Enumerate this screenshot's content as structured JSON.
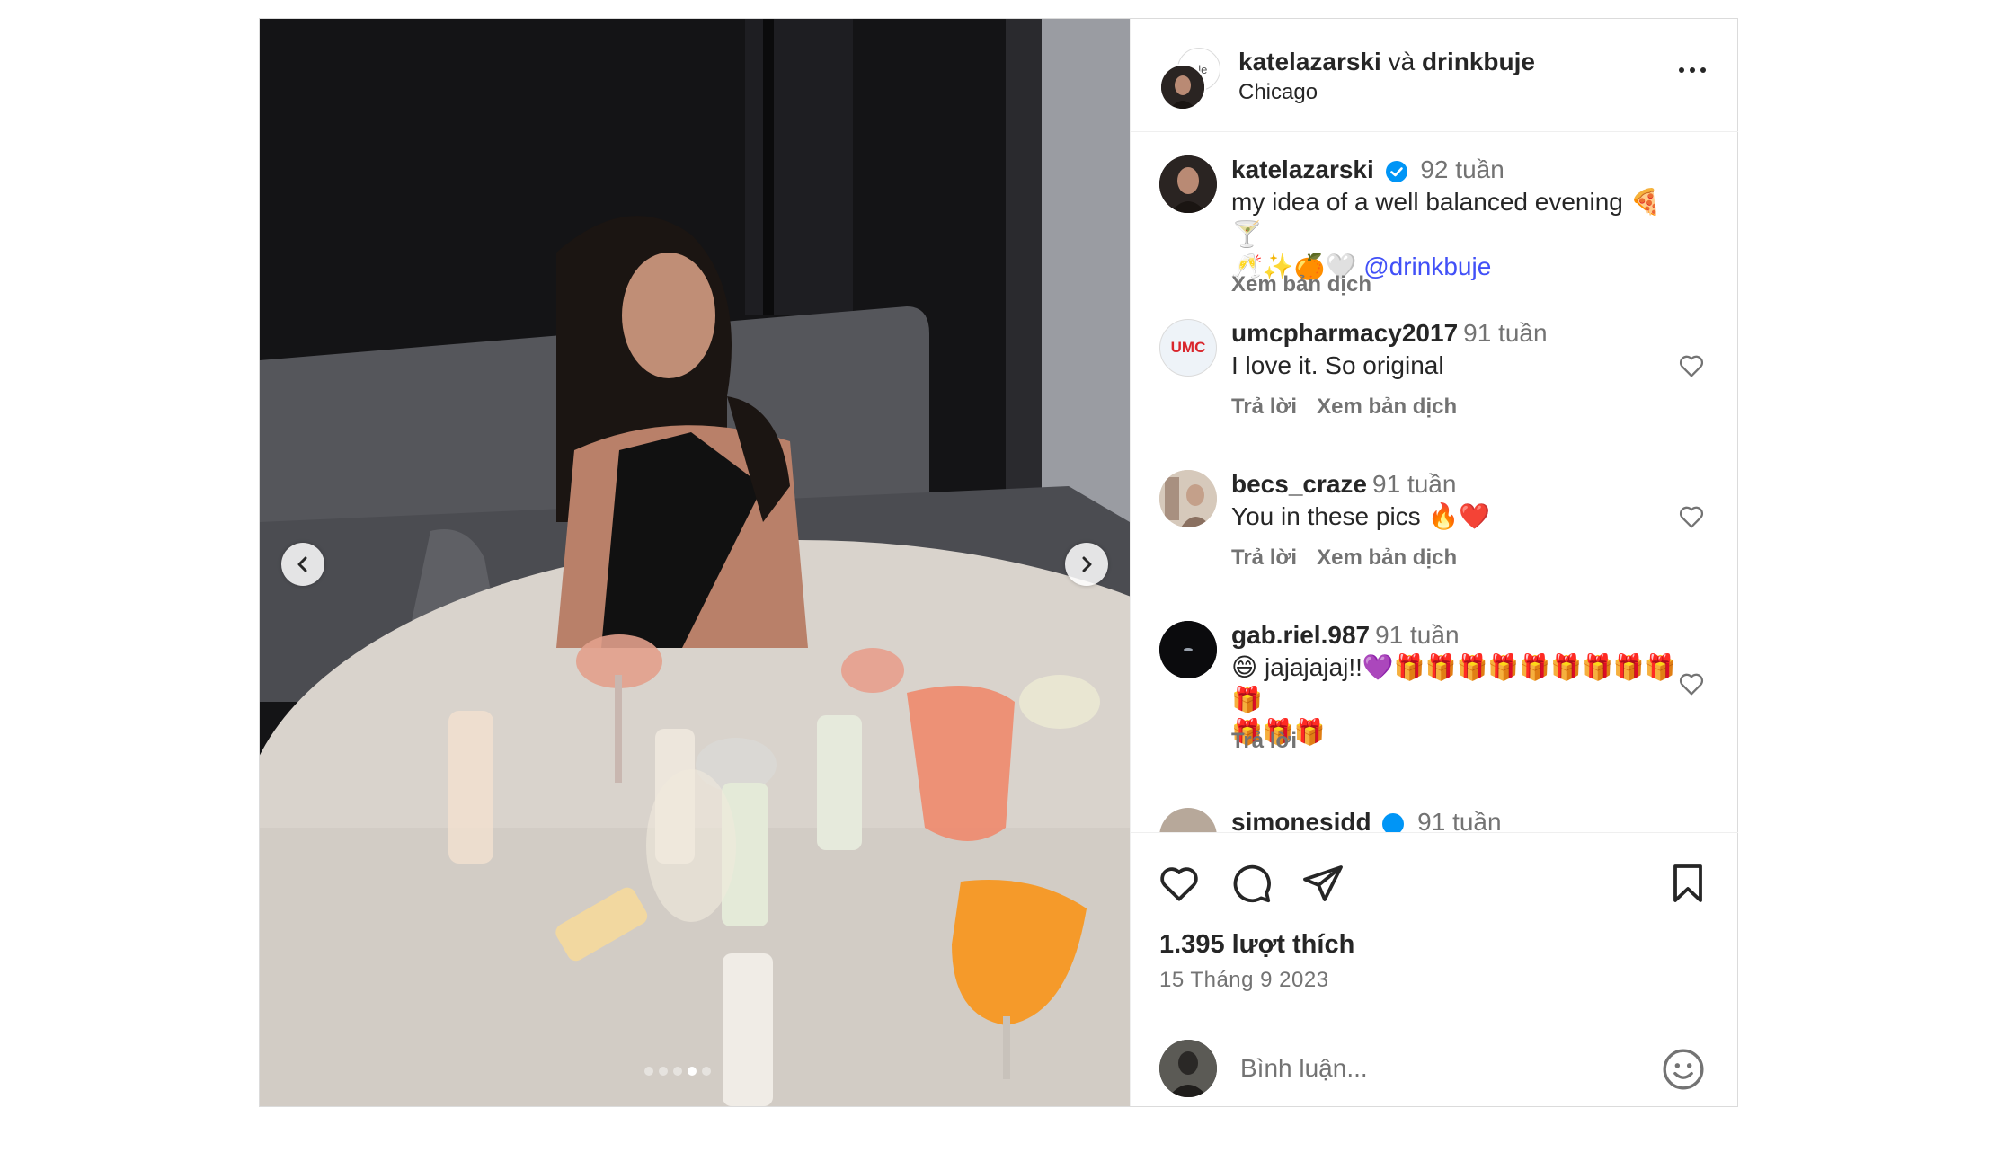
{
  "header": {
    "author": "katelazarski",
    "and_text": "và",
    "collaborator": "drinkbuje",
    "location": "Chicago",
    "collab_avatar_text": "Ele"
  },
  "caption": {
    "user": "katelazarski",
    "time": "92 tuần",
    "text": "my idea of a well balanced evening 🍕🍸",
    "text2": "🥂✨🍊🤍",
    "mention": "@drinkbuje",
    "translate": "Xem bản dịch",
    "verified": true
  },
  "comments": [
    {
      "user": "umcpharmacy2017",
      "time": "91 tuần",
      "text": "I love it. So original",
      "reply": "Trả lời",
      "translate": "Xem bản dịch",
      "avatar_text": "UMC"
    },
    {
      "user": "becs_craze",
      "time": "91 tuần",
      "text": "You in these pics 🔥❤️",
      "reply": "Trả lời",
      "translate": "Xem bản dịch"
    },
    {
      "user": "gab.riel.987",
      "time": "91 tuần",
      "text": "😄 jajajajaj!!💜🎁🎁🎁🎁🎁🎁🎁🎁🎁🎁",
      "text2": "🎁🎁🎁",
      "reply": "Trả lời"
    },
    {
      "user": "simonesidd",
      "time": "91 tuần"
    }
  ],
  "likes": "1.395 lượt thích",
  "date": "15 Tháng 9 2023",
  "comment_box": {
    "placeholder": "Bình luận..."
  },
  "carousel": {
    "total": 5,
    "active_index": 3
  },
  "icons": {
    "like": "heart-icon",
    "comment": "comment-icon",
    "share": "share-icon",
    "save": "bookmark-icon",
    "emoji": "emoji-icon",
    "prev": "chevron-left-icon",
    "next": "chevron-right-icon"
  },
  "colors": {
    "mention": "#4150f7",
    "verified": "#0095f6",
    "secondary_text": "#737373"
  }
}
